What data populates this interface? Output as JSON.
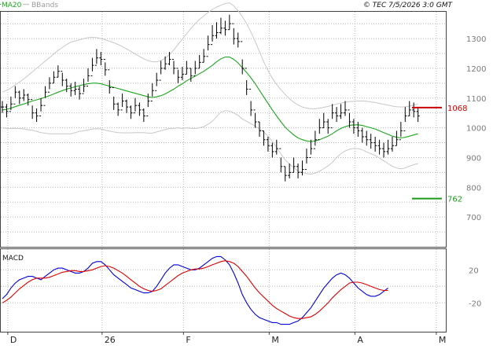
{
  "header": {
    "legend_ma": "MA20",
    "legend_bb": "BBands",
    "source": "© TEC 7/5/2026 3:0 GMT"
  },
  "colors": {
    "ma": "#1fa51f",
    "bbands": "#c8c8c8",
    "bars": "#000000",
    "resistance": "#cc0000",
    "support": "#1a9a1a",
    "macd": "#0000dd",
    "signal": "#dd0000",
    "grid": "#b8b8b8"
  },
  "chart_data": [
    {
      "type": "ohlc",
      "title": "",
      "legend": [
        "MA20",
        "BBands"
      ],
      "y_ticks": [
        700,
        800,
        900,
        1000,
        1100,
        1200,
        1300
      ],
      "ylim": [
        600,
        1390
      ],
      "x_labels": [
        "D",
        "26",
        "F",
        "M",
        "A",
        "M"
      ],
      "x_label_index": [
        2,
        24,
        43,
        63,
        83,
        102
      ],
      "levels": [
        {
          "name": "resistance",
          "value": 1068,
          "label": "1068"
        },
        {
          "name": "support",
          "value": 762,
          "label": "762"
        }
      ],
      "close": [
        1070,
        1055,
        1080,
        1120,
        1100,
        1110,
        1095,
        1050,
        1040,
        1075,
        1120,
        1150,
        1170,
        1190,
        1160,
        1140,
        1125,
        1130,
        1115,
        1140,
        1175,
        1210,
        1235,
        1230,
        1195,
        1135,
        1080,
        1060,
        1090,
        1070,
        1050,
        1075,
        1060,
        1040,
        1090,
        1125,
        1160,
        1200,
        1215,
        1230,
        1200,
        1170,
        1180,
        1200,
        1175,
        1200,
        1220,
        1240,
        1280,
        1310,
        1320,
        1335,
        1330,
        1350,
        1300,
        1290,
        1200,
        1130,
        1060,
        1020,
        990,
        960,
        940,
        920,
        930,
        870,
        840,
        850,
        870,
        850,
        860,
        900,
        930,
        960,
        1000,
        1020,
        1000,
        1050,
        1040,
        1050,
        1060,
        1020,
        1000,
        990,
        970,
        960,
        950,
        940,
        930,
        920,
        930,
        940,
        960,
        990,
        1040,
        1060,
        1055,
        1040
      ],
      "high": [
        1090,
        1080,
        1105,
        1140,
        1125,
        1130,
        1115,
        1075,
        1065,
        1100,
        1140,
        1170,
        1190,
        1210,
        1185,
        1165,
        1150,
        1155,
        1140,
        1165,
        1200,
        1235,
        1265,
        1255,
        1220,
        1160,
        1105,
        1085,
        1115,
        1095,
        1075,
        1100,
        1085,
        1065,
        1115,
        1150,
        1185,
        1225,
        1240,
        1255,
        1225,
        1195,
        1205,
        1225,
        1200,
        1225,
        1245,
        1265,
        1310,
        1345,
        1355,
        1370,
        1360,
        1380,
        1335,
        1320,
        1230,
        1160,
        1090,
        1050,
        1020,
        990,
        970,
        950,
        960,
        900,
        870,
        880,
        900,
        880,
        890,
        930,
        960,
        990,
        1030,
        1050,
        1030,
        1080,
        1070,
        1080,
        1090,
        1050,
        1030,
        1020,
        1000,
        990,
        980,
        970,
        960,
        950,
        960,
        970,
        990,
        1020,
        1070,
        1090,
        1085,
        1070
      ],
      "low": [
        1050,
        1035,
        1060,
        1100,
        1080,
        1090,
        1075,
        1030,
        1020,
        1055,
        1100,
        1130,
        1150,
        1170,
        1140,
        1120,
        1105,
        1110,
        1095,
        1120,
        1155,
        1190,
        1215,
        1210,
        1175,
        1115,
        1060,
        1040,
        1070,
        1050,
        1030,
        1055,
        1040,
        1020,
        1070,
        1105,
        1140,
        1180,
        1195,
        1210,
        1180,
        1150,
        1160,
        1180,
        1155,
        1180,
        1200,
        1220,
        1260,
        1290,
        1300,
        1315,
        1310,
        1330,
        1280,
        1270,
        1180,
        1110,
        1040,
        1000,
        970,
        940,
        920,
        900,
        910,
        850,
        820,
        830,
        850,
        830,
        840,
        880,
        910,
        940,
        980,
        1000,
        980,
        1030,
        1020,
        1030,
        1040,
        1000,
        980,
        970,
        950,
        940,
        930,
        920,
        910,
        900,
        910,
        920,
        940,
        970,
        1020,
        1040,
        1035,
        1020
      ],
      "ma20": [
        1060,
        1062,
        1066,
        1071,
        1076,
        1080,
        1085,
        1090,
        1094,
        1098,
        1103,
        1108,
        1114,
        1120,
        1125,
        1130,
        1134,
        1138,
        1142,
        1145,
        1148,
        1150,
        1150,
        1148,
        1144,
        1140,
        1136,
        1132,
        1128,
        1124,
        1120,
        1116,
        1112,
        1108,
        1104,
        1102,
        1104,
        1108,
        1114,
        1122,
        1130,
        1140,
        1148,
        1158,
        1166,
        1174,
        1182,
        1190,
        1200,
        1210,
        1222,
        1232,
        1238,
        1238,
        1230,
        1218,
        1202,
        1186,
        1168,
        1148,
        1126,
        1104,
        1082,
        1060,
        1040,
        1020,
        1002,
        988,
        976,
        966,
        960,
        956,
        954,
        956,
        960,
        966,
        972,
        980,
        990,
        998,
        1004,
        1008,
        1010,
        1010,
        1008,
        1004,
        1000,
        996,
        990,
        984,
        978,
        972,
        968,
        966,
        968,
        972,
        976,
        980
      ],
      "bb_upper": [
        1120,
        1126,
        1134,
        1144,
        1154,
        1164,
        1176,
        1188,
        1200,
        1212,
        1224,
        1236,
        1248,
        1260,
        1270,
        1280,
        1288,
        1292,
        1296,
        1300,
        1303,
        1304,
        1303,
        1300,
        1296,
        1291,
        1286,
        1280,
        1273,
        1265,
        1257,
        1248,
        1240,
        1232,
        1226,
        1222,
        1222,
        1226,
        1234,
        1246,
        1262,
        1280,
        1298,
        1316,
        1334,
        1350,
        1364,
        1376,
        1388,
        1398,
        1406,
        1412,
        1418,
        1420,
        1410,
        1394,
        1374,
        1350,
        1322,
        1290,
        1256,
        1222,
        1192,
        1166,
        1146,
        1128,
        1112,
        1098,
        1086,
        1077,
        1070,
        1066,
        1064,
        1064,
        1066,
        1069,
        1072,
        1076,
        1080,
        1083,
        1086,
        1088,
        1089,
        1090,
        1090,
        1089,
        1087,
        1085,
        1082,
        1079,
        1076,
        1073,
        1071,
        1070,
        1071,
        1073,
        1076,
        1080
      ],
      "bb_lower": [
        1000,
        998,
        998,
        998,
        998,
        996,
        994,
        992,
        988,
        984,
        982,
        980,
        980,
        980,
        980,
        980,
        980,
        984,
        988,
        990,
        993,
        996,
        997,
        996,
        992,
        989,
        986,
        984,
        983,
        983,
        983,
        984,
        984,
        984,
        982,
        982,
        986,
        990,
        994,
        998,
        998,
        1000,
        998,
        1000,
        998,
        998,
        1000,
        1004,
        1012,
        1022,
        1038,
        1052,
        1058,
        1056,
        1050,
        1042,
        1030,
        1022,
        1014,
        1006,
        996,
        986,
        972,
        954,
        934,
        912,
        892,
        878,
        866,
        855,
        850,
        846,
        844,
        848,
        854,
        863,
        872,
        884,
        900,
        913,
        922,
        928,
        931,
        930,
        926,
        919,
        913,
        907,
        898,
        889,
        880,
        871,
        865,
        862,
        865,
        871,
        876,
        880
      ]
    },
    {
      "type": "line",
      "title": "MACD",
      "y_ticks": [
        20,
        -20
      ],
      "ylim": [
        -55,
        45
      ],
      "series": [
        {
          "name": "MACD",
          "values": [
            -15,
            -10,
            -2,
            4,
            8,
            10,
            12,
            12,
            10,
            8,
            12,
            16,
            20,
            22,
            22,
            20,
            18,
            16,
            16,
            18,
            22,
            28,
            30,
            30,
            26,
            20,
            14,
            10,
            6,
            2,
            -2,
            -4,
            -6,
            -8,
            -8,
            -6,
            0,
            8,
            16,
            22,
            26,
            26,
            24,
            22,
            20,
            20,
            22,
            26,
            30,
            34,
            36,
            36,
            32,
            26,
            16,
            4,
            -10,
            -20,
            -28,
            -34,
            -38,
            -40,
            -42,
            -44,
            -44,
            -46,
            -46,
            -46,
            -44,
            -42,
            -38,
            -32,
            -26,
            -18,
            -10,
            -2,
            4,
            10,
            14,
            16,
            14,
            10,
            4,
            -2,
            -6,
            -10,
            -12,
            -12,
            -10,
            -6,
            -2
          ]
        },
        {
          "name": "Signal",
          "values": [
            -20,
            -17,
            -13,
            -8,
            -3,
            1,
            5,
            8,
            10,
            10,
            10,
            11,
            13,
            15,
            17,
            18,
            19,
            19,
            18,
            18,
            19,
            20,
            22,
            24,
            25,
            24,
            22,
            19,
            16,
            12,
            8,
            4,
            0,
            -3,
            -5,
            -6,
            -5,
            -3,
            1,
            5,
            9,
            13,
            16,
            18,
            20,
            21,
            21,
            22,
            24,
            26,
            28,
            30,
            31,
            30,
            28,
            24,
            18,
            12,
            5,
            -2,
            -8,
            -13,
            -18,
            -23,
            -27,
            -30,
            -33,
            -36,
            -38,
            -39,
            -39,
            -38,
            -37,
            -34,
            -30,
            -25,
            -20,
            -14,
            -9,
            -4,
            0,
            4,
            5,
            5,
            4,
            2,
            0,
            -2,
            -4,
            -5,
            -5
          ]
        }
      ]
    }
  ]
}
